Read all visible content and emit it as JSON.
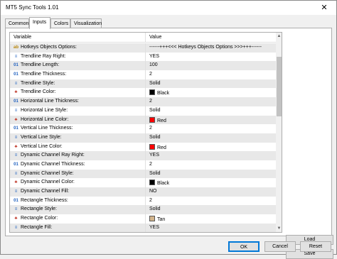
{
  "window": {
    "title": "MT5 Sync Tools 1.01",
    "close_glyph": "✕"
  },
  "tabs": [
    {
      "label": "Common"
    },
    {
      "label": "Inputs"
    },
    {
      "label": "Colors"
    },
    {
      "label": "Visualization"
    }
  ],
  "grid": {
    "col_variable": "Variable",
    "col_value": "Value",
    "rows": [
      {
        "icon": "ab",
        "variable": "Hotkeys Objects Options:",
        "value": "------+++<<< Hotkeys Objects Options >>>+++------"
      },
      {
        "icon": "bool",
        "variable": "Trendline Ray Right:",
        "value": "YES"
      },
      {
        "icon": "01",
        "variable": "Trendline Length:",
        "value": "100"
      },
      {
        "icon": "01",
        "variable": "Trendline Thickness:",
        "value": "2"
      },
      {
        "icon": "enum",
        "variable": "Trendline Style:",
        "value": "Solid"
      },
      {
        "icon": "color",
        "variable": "Trendline Color:",
        "value": "Black",
        "swatch": "#000000"
      },
      {
        "icon": "01",
        "variable": "Horizontal Line Thickness:",
        "value": "2"
      },
      {
        "icon": "enum",
        "variable": "Horizontal Line Style:",
        "value": "Solid"
      },
      {
        "icon": "color",
        "variable": "Horizontal Line Color:",
        "value": "Red",
        "swatch": "#ff0000"
      },
      {
        "icon": "01",
        "variable": "Vertical Line Thickness:",
        "value": "2"
      },
      {
        "icon": "enum",
        "variable": "Vertical Line Style:",
        "value": "Solid"
      },
      {
        "icon": "color",
        "variable": "Vertical Line Color:",
        "value": "Red",
        "swatch": "#ff0000"
      },
      {
        "icon": "bool",
        "variable": "Dynamic Channel Ray Right:",
        "value": "YES"
      },
      {
        "icon": "01",
        "variable": "Dynamic Channel Thickness:",
        "value": "2"
      },
      {
        "icon": "enum",
        "variable": "Dynamic Channel Style:",
        "value": "Solid"
      },
      {
        "icon": "color",
        "variable": "Dynamic Channel Color:",
        "value": "Black",
        "swatch": "#000000"
      },
      {
        "icon": "bool",
        "variable": "Dynamic Channel Fill:",
        "value": "NO"
      },
      {
        "icon": "01",
        "variable": "Rectangle Thickness:",
        "value": "2"
      },
      {
        "icon": "enum",
        "variable": "Rectangle Style:",
        "value": "Solid"
      },
      {
        "icon": "color",
        "variable": "Rectangle Color:",
        "value": "Tan",
        "swatch": "#d2b48c"
      },
      {
        "icon": "bool",
        "variable": "Rectangle Fill:",
        "value": "YES"
      }
    ]
  },
  "buttons": {
    "load": "Load",
    "save": "Save",
    "ok": "OK",
    "cancel": "Cancel",
    "reset": "Reset"
  },
  "scrollbar": {
    "up": "▲",
    "down": "▼"
  }
}
